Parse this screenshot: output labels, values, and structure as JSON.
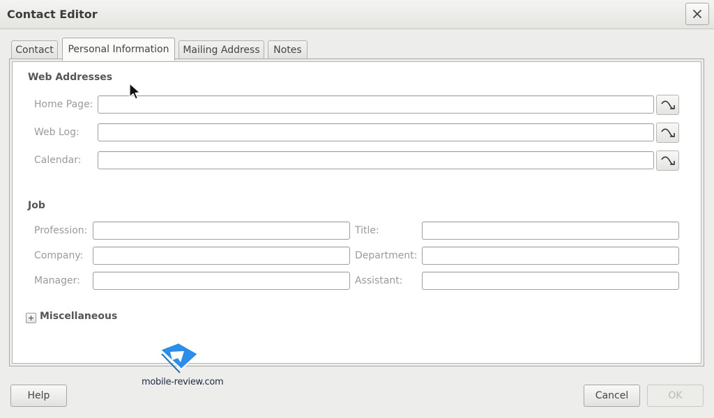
{
  "window": {
    "title": "Contact Editor",
    "close_icon": "close-icon"
  },
  "tabs": [
    {
      "label": "Contact",
      "active": false
    },
    {
      "label": "Personal Information",
      "active": true
    },
    {
      "label": "Mailing Address",
      "active": false
    },
    {
      "label": "Notes",
      "active": false
    }
  ],
  "web_addresses": {
    "title": "Web Addresses",
    "home_page": {
      "label": "Home Page:",
      "value": ""
    },
    "web_log": {
      "label": "Web Log:",
      "value": ""
    },
    "calendar": {
      "label": "Calendar:",
      "value": ""
    },
    "open_link_icon": "open-url-arrow-icon"
  },
  "job": {
    "title": "Job",
    "profession": {
      "label": "Profession:",
      "value": ""
    },
    "title_field": {
      "label": "Title:",
      "value": ""
    },
    "company": {
      "label": "Company:",
      "value": ""
    },
    "department": {
      "label": "Department:",
      "value": ""
    },
    "manager": {
      "label": "Manager:",
      "value": ""
    },
    "assistant": {
      "label": "Assistant:",
      "value": ""
    }
  },
  "miscellaneous": {
    "title": "Miscellaneous",
    "expanded": false
  },
  "buttons": {
    "help": "Help",
    "cancel": "Cancel",
    "ok": "OK",
    "ok_enabled": false
  },
  "watermark": {
    "text": "mobile-review.com",
    "logo_color": "#2d8ee8"
  }
}
